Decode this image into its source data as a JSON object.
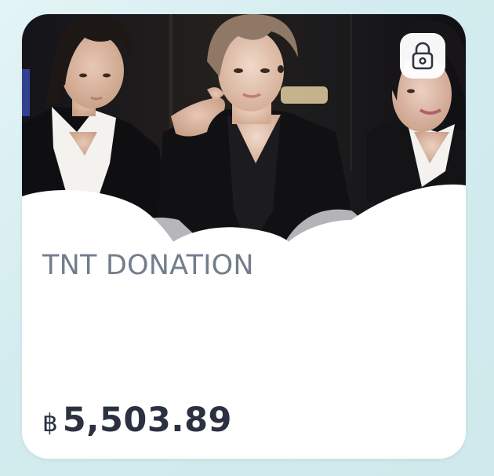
{
  "card": {
    "title": "TNT DONATION",
    "currency_symbol": "฿",
    "balance": "5,503.89",
    "lock_icon": "lock-icon",
    "image": "group-photo",
    "colors": {
      "background": "#d8eef1",
      "card": "#ffffff",
      "title": "#737d8c",
      "amount": "#2b3140"
    }
  }
}
